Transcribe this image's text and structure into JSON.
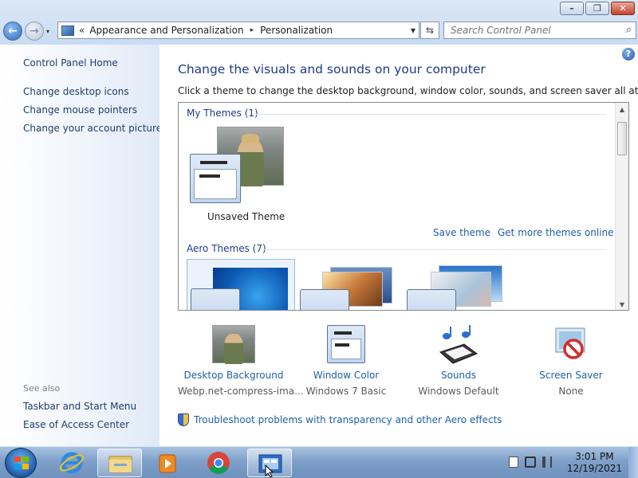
{
  "window": {
    "minimize_glyph": "–",
    "maximize_glyph": "❐",
    "close_glyph": "✕"
  },
  "nav": {
    "back_glyph": "←",
    "forward_glyph": "→",
    "history_glyph": "▾"
  },
  "address": {
    "overflow": "«",
    "crumbs": [
      "Appearance and Personalization",
      "Personalization"
    ],
    "separator": "▸",
    "dropdown": "▼",
    "refresh_glyph": "⇆"
  },
  "search": {
    "placeholder": "Search Control Panel",
    "icon_glyph": "⌕"
  },
  "left_pane": {
    "home": "Control Panel Home",
    "links": [
      "Change desktop icons",
      "Change mouse pointers",
      "Change your account picture"
    ],
    "see_also_label": "See also",
    "see_also_links": [
      "Taskbar and Start Menu",
      "Ease of Access Center"
    ]
  },
  "main": {
    "help_glyph": "?",
    "heading": "Change the visuals and sounds on your computer",
    "subheading": "Click a theme to change the desktop background, window color, sounds, and screen saver all at once.",
    "my_themes_label": "My Themes (1)",
    "unsaved_theme_label": "Unsaved Theme",
    "save_theme": "Save theme",
    "get_more_themes": "Get more themes online",
    "aero_themes_label": "Aero Themes (7)",
    "scroll_up": "▲",
    "scroll_down": "▼"
  },
  "bottom_items": [
    {
      "title": "Desktop Background",
      "value": "Webp.net-compress-ima...",
      "icon": "desktop-background-icon"
    },
    {
      "title": "Window Color",
      "value": "Windows 7 Basic",
      "icon": "window-color-icon"
    },
    {
      "title": "Sounds",
      "value": "Windows Default",
      "icon": "sounds-icon"
    },
    {
      "title": "Screen Saver",
      "value": "None",
      "icon": "screen-saver-icon"
    }
  ],
  "troubleshoot_link": "Troubleshoot problems with transparency and other Aero effects",
  "taskbar": {
    "time": "3:01 PM",
    "date": "12/19/2021",
    "pinned": [
      "internet-explorer-icon",
      "file-explorer-icon",
      "media-player-icon",
      "chrome-icon",
      "control-panel-icon"
    ]
  },
  "colors": {
    "link_blue": "#1e5fa8",
    "heading_blue": "#1e3b8a",
    "taskbar": "#7ea0c9"
  }
}
